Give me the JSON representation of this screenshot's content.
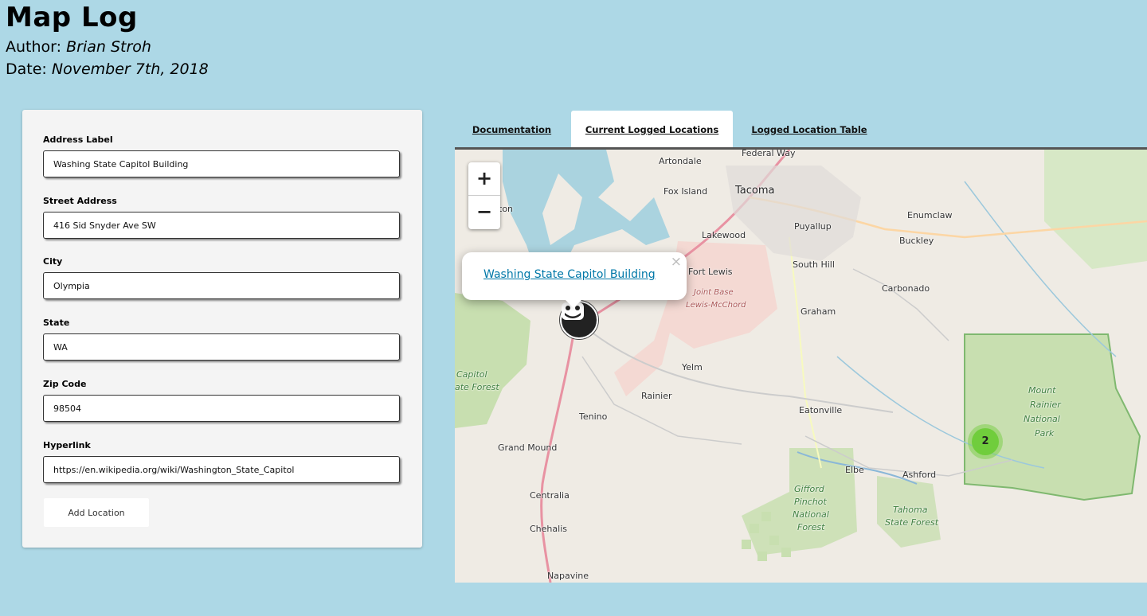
{
  "header": {
    "title": "Map Log",
    "author_label": "Author:",
    "author_name": "Brian Stroh",
    "date_label": "Date:",
    "date_value": "November 7th, 2018"
  },
  "form": {
    "fields": [
      {
        "label": "Address Label",
        "value": "Washing State Capitol Building"
      },
      {
        "label": "Street Address",
        "value": "416 Sid Snyder Ave SW"
      },
      {
        "label": "City",
        "value": "Olympia"
      },
      {
        "label": "State",
        "value": "WA"
      },
      {
        "label": "Zip Code",
        "value": "98504"
      },
      {
        "label": "Hyperlink",
        "value": "https://en.wikipedia.org/wiki/Washington_State_Capitol"
      }
    ],
    "submit_label": "Add Location"
  },
  "tabs": [
    {
      "label": "Documentation"
    },
    {
      "label": "Current Logged Locations",
      "active": true
    },
    {
      "label": "Logged Location Table"
    }
  ],
  "map": {
    "zoom_in": "+",
    "zoom_out": "−",
    "popup_link": "Washing State Capitol Building",
    "popup_close": "×",
    "cluster_count": "2",
    "colors": {
      "cluster": "#6ecc39",
      "water": "#aad3df",
      "park": "#c8dfb0",
      "link": "#0078a8"
    },
    "place_labels": {
      "federal_way": "Federal Way",
      "artondale": "Artondale",
      "fox_island": "Fox Island",
      "tacoma": "Tacoma",
      "puyallup": "Puyallup",
      "enumclaw": "Enumclaw",
      "buckley": "Buckley",
      "lakewood": "Lakewood",
      "fort_lewis": "Fort Lewis",
      "south_hill": "South Hill",
      "carbonado": "Carbonado",
      "joint_base": "Joint Base",
      "lewis_mcchord": "Lewis-McChord",
      "graham": "Graham",
      "yelm": "Yelm",
      "rainier": "Rainier",
      "tenino": "Tenino",
      "eatonville": "Eatonville",
      "grand_mound": "Grand Mound",
      "elbe": "Elbe",
      "ashford": "Ashford",
      "centralia": "Centralia",
      "chehalis": "Chehalis",
      "napavine": "Napavine",
      "mount": "Mount",
      "rainier_np": "Rainier",
      "national": "National",
      "park": "Park",
      "gifford": "Gifford",
      "pinchot": "Pinchot",
      "national_forest": "National",
      "forest": "Forest",
      "elbe_hills": "Tahoma",
      "state_forest": "State Forest",
      "capitol": "Capitol",
      "state_forest_left": "ate Forest",
      "ton": "ton"
    }
  }
}
